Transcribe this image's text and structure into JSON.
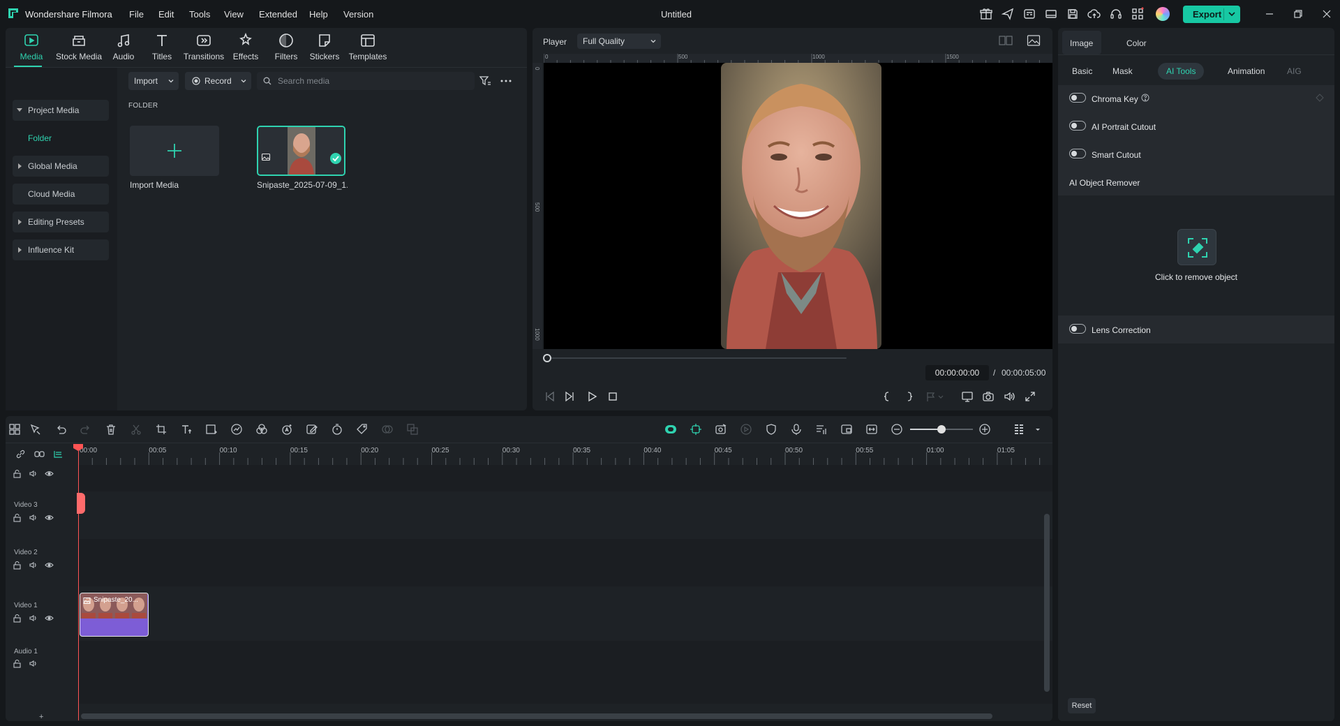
{
  "app": {
    "name": "Wondershare Filmora",
    "doc_title": "Untitled",
    "export_label": "Export",
    "accent": "#2fd3b0",
    "export_bg": "#17c8a3"
  },
  "menu": [
    "File",
    "Edit",
    "Tools",
    "View",
    "Extended",
    "Help",
    "Version"
  ],
  "titlebar_icons": [
    "gift-icon",
    "send-icon",
    "subtitle-icon",
    "layout-icon",
    "save-icon",
    "cloud-upload-icon",
    "headset-icon",
    "grid-icon",
    "avatar"
  ],
  "media_tabs": [
    {
      "label": "Media",
      "icon": "media-icon",
      "active": true
    },
    {
      "label": "Stock Media",
      "icon": "stock-media-icon"
    },
    {
      "label": "Audio",
      "icon": "audio-icon"
    },
    {
      "label": "Titles",
      "icon": "titles-icon"
    },
    {
      "label": "Transitions",
      "icon": "transitions-icon"
    },
    {
      "label": "Effects",
      "icon": "effects-icon"
    },
    {
      "label": "Filters",
      "icon": "filters-icon"
    },
    {
      "label": "Stickers",
      "icon": "stickers-icon"
    },
    {
      "label": "Templates",
      "icon": "templates-icon"
    }
  ],
  "sidebar": {
    "project_media": "Project Media",
    "folder": "Folder",
    "global_media": "Global Media",
    "cloud_media": "Cloud Media",
    "editing_presets": "Editing Presets",
    "influence_kit": "Influence Kit"
  },
  "media_toolbar": {
    "import_label": "Import",
    "record_label": "Record",
    "search_placeholder": "Search media"
  },
  "media": {
    "folder_heading": "FOLDER",
    "import_label": "Import Media",
    "clip_name": "Snipaste_2025-07-09_1..."
  },
  "player": {
    "label": "Player",
    "quality": "Full Quality",
    "ruler_ticks": [
      "0",
      "500",
      "1000",
      "1500"
    ],
    "vruler_ticks": [
      "0",
      "500",
      "1000"
    ],
    "current_time": "00:00:00:00",
    "separator": "/",
    "total_time": "00:00:05:00",
    "progress": 0
  },
  "properties": {
    "tabs": [
      "Image",
      "Color"
    ],
    "subtabs": [
      "Basic",
      "Mask",
      "AI Tools",
      "Animation",
      "AIG"
    ],
    "active_subtab": "AI Tools",
    "chroma_key": "Chroma Key",
    "ai_portrait": "AI Portrait Cutout",
    "smart_cutout": "Smart Cutout",
    "ai_object_remover": "AI Object Remover",
    "click_remove": "Click to remove object",
    "lens_correction": "Lens Correction",
    "reset": "Reset"
  },
  "timeline": {
    "ticks": [
      "00:00",
      "00:05",
      "00:10",
      "00:15",
      "00:20",
      "00:25",
      "00:30",
      "00:35",
      "00:40",
      "00:45",
      "00:50",
      "00:55",
      "01:00",
      "01:05"
    ],
    "tracks": [
      "Video 3",
      "Video 2",
      "Video 1",
      "Audio 1"
    ],
    "clip_label": "Snipaste_20...",
    "zoom_level": 0.5
  }
}
